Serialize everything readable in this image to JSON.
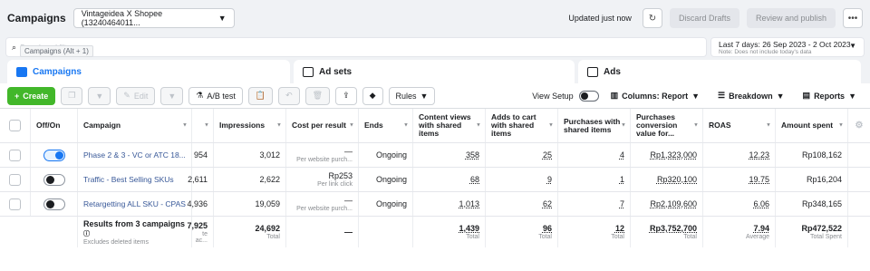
{
  "header": {
    "title": "Campaigns",
    "account": "Vintageidea X Shopee (13240464011...",
    "updated": "Updated just now",
    "discard": "Discard Drafts",
    "review": "Review and publish",
    "more": "•••"
  },
  "search": {
    "placeholder": "Search and filter",
    "tooltip": "Campaigns (Alt + 1)"
  },
  "date": {
    "range": "Last 7 days: 26 Sep 2023 - 2 Oct 2023",
    "note": "Note: Does not include today's data"
  },
  "tabs": {
    "campaigns": "Campaigns",
    "adsets": "Ad sets",
    "ads": "Ads"
  },
  "toolbar": {
    "create": "Create",
    "edit": "Edit",
    "ab_test": "A/B test",
    "rules": "Rules",
    "view_setup": "View Setup",
    "columns": "Columns: Report",
    "breakdown": "Breakdown",
    "reports": "Reports"
  },
  "table": {
    "headers": {
      "onoff": "Off/On",
      "campaign": "Campaign",
      "impressions": "Impressions",
      "cpr": "Cost per result",
      "ends": "Ends",
      "content_views": "Content views with shared items",
      "atc": "Adds to cart with shared items",
      "purchases": "Purchases with shared items",
      "pcv": "Purchases conversion value for...",
      "roas": "ROAS",
      "spent": "Amount spent"
    },
    "rows": [
      {
        "name": "Phase 2 & 3 - VC or ATC 18...",
        "reach": "954",
        "impressions": "3,012",
        "cpr": "—",
        "cpr_sub": "Per website purch...",
        "ends": "Ongoing",
        "cv": "358",
        "atc": "25",
        "purchases": "4",
        "pcv": "Rp1,323,000",
        "roas": "12.23",
        "spent": "Rp108,162"
      },
      {
        "name": "Traffic - Best Selling SKUs",
        "reach": "2,611",
        "impressions": "2,622",
        "cpr": "Rp253",
        "cpr_sub": "Per link click",
        "ends": "Ongoing",
        "cv": "68",
        "atc": "9",
        "purchases": "1",
        "pcv": "Rp320,100",
        "roas": "19.75",
        "spent": "Rp16,204"
      },
      {
        "name": "Retargetting ALL SKU - CPAS",
        "reach": "4,936",
        "impressions": "19,059",
        "cpr": "—",
        "cpr_sub": "Per website purch...",
        "ends": "Ongoing",
        "cv": "1,013",
        "atc": "62",
        "purchases": "7",
        "pcv": "Rp2,109,600",
        "roas": "6.06",
        "spent": "Rp348,165"
      }
    ],
    "total": {
      "label": "Results from 3 campaigns",
      "sub": "Excludes deleted items",
      "reach": "7,925",
      "reach_sub": "te ac...",
      "impressions": "24,692",
      "impressions_sub": "Total",
      "cpr": "—",
      "cv": "1,439",
      "cv_sub": "Total",
      "atc": "96",
      "atc_sub": "Total",
      "purchases": "12",
      "purchases_sub": "Total",
      "pcv": "Rp3,752,700",
      "pcv_sub": "Total",
      "roas": "7.94",
      "roas_sub": "Average",
      "spent": "Rp472,522",
      "spent_sub": "Total Spent"
    }
  }
}
